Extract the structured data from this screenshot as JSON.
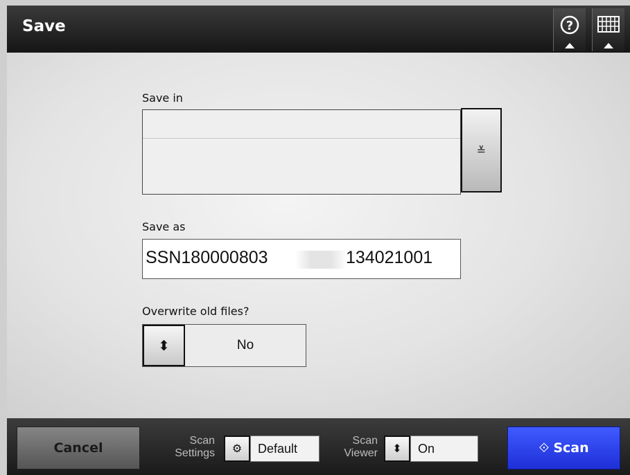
{
  "header": {
    "title": "Save"
  },
  "save_in": {
    "label": "Save in",
    "dropdown_glyph": "≚"
  },
  "save_as": {
    "label": "Save as",
    "value_prefix": "SSN180000803",
    "value_suffix": "134021001"
  },
  "overwrite": {
    "label": "Overwrite old files?",
    "toggle_glyph": "⬍",
    "value": "No"
  },
  "footer": {
    "cancel_label": "Cancel",
    "scan_settings_label_line1": "Scan",
    "scan_settings_label_line2": "Settings",
    "scan_settings_icon": "⚙",
    "scan_settings_value": "Default",
    "scan_viewer_label_line1": "Scan",
    "scan_viewer_label_line2": "Viewer",
    "scan_viewer_toggle": "⬍",
    "scan_viewer_value": "On",
    "scan_icon": "⟐",
    "scan_label": "Scan"
  },
  "icons": {
    "help": "help-icon",
    "keyboard": "keyboard-icon"
  },
  "colors": {
    "scan_button": "#2a3cf0",
    "header_bg": "#1e1e1e",
    "cancel_button": "#6c6c6c"
  }
}
